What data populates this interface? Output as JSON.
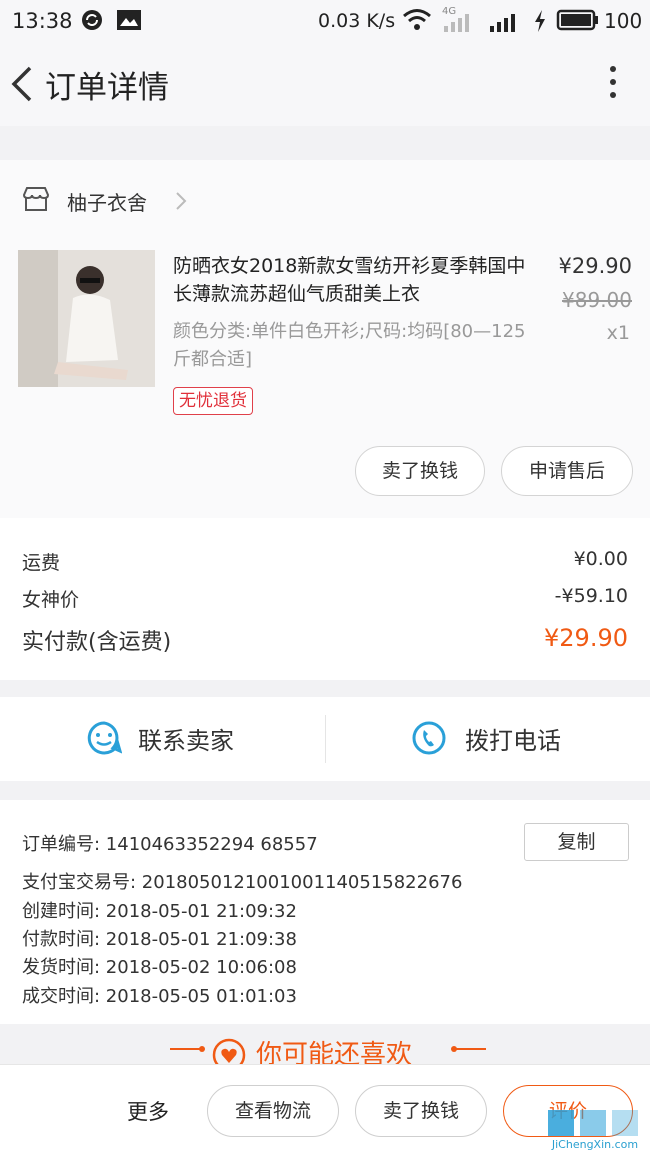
{
  "status_bar": {
    "time": "13:38",
    "net_speed": "0.03 K/s",
    "network": "4G",
    "battery": "100",
    "icons": [
      "sync-icon",
      "image-icon",
      "wifi-icon",
      "signal-icon",
      "charging-icon",
      "battery-icon"
    ]
  },
  "nav": {
    "title": "订单详情",
    "back_icon": "chevron-left-icon",
    "more_icon": "more-vertical-icon"
  },
  "shop": {
    "name": "柚子衣舍",
    "icon": "store-icon"
  },
  "product": {
    "title": "防晒衣女2018新款女雪纺开衫夏季韩国中长薄款流苏超仙气质甜美上衣",
    "sku": "颜色分类:单件白色开衫;尺码:均码[80—125斤都合适]",
    "price": "¥29.90",
    "original_price": "¥89.00",
    "quantity": "x1",
    "tag": "无忧退货",
    "buttons": [
      "卖了换钱",
      "申请售后"
    ]
  },
  "fees": {
    "shipping_label": "运费",
    "shipping_value": "¥0.00",
    "discount_label": "女神价",
    "discount_value": "-¥59.10",
    "total_label": "实付款(含运费)",
    "total_value": "¥29.90",
    "accent": "#f05a14"
  },
  "contact": {
    "seller_label": "联系卖家",
    "call_label": "拨打电话",
    "accent": "#2aa0d8"
  },
  "order_info": {
    "order_no": "订单编号:  1410463352294 68557",
    "copy_label": "复制",
    "alipay_no": "支付宝交易号:  2018050121001001140515822676",
    "created": "创建时间:  2018-05-01 21:09:32",
    "paid": "付款时间:  2018-05-01 21:09:38",
    "shipped": "发货时间:  2018-05-02 10:06:08",
    "completed": "成交时间:  2018-05-05 01:01:03"
  },
  "recommend": {
    "title": "你可能还喜欢"
  },
  "bottom_bar": {
    "more": "更多",
    "logistics": "查看物流",
    "sell": "卖了换钱",
    "review": "评价"
  },
  "watermark": {
    "text": "JiChengXin.com"
  }
}
